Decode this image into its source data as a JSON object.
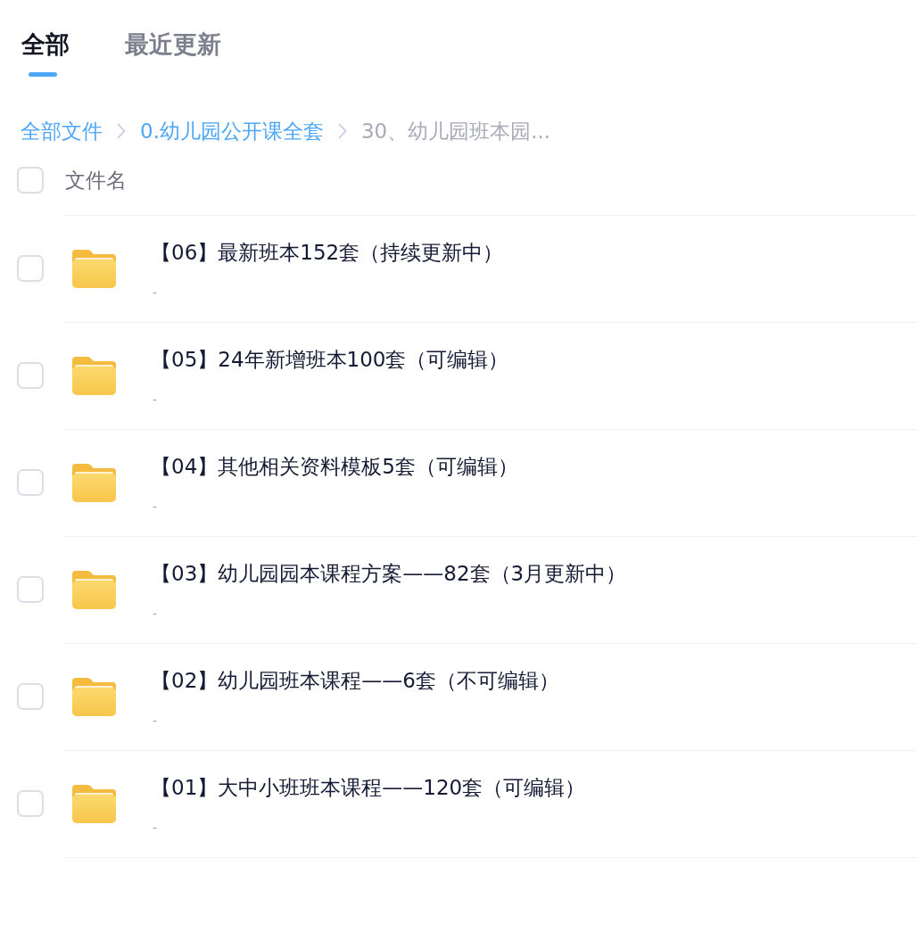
{
  "tabs": [
    {
      "label": "全部",
      "selected": true
    },
    {
      "label": "最近更新",
      "selected": false
    }
  ],
  "breadcrumb": [
    {
      "label": "全部文件",
      "current": false
    },
    {
      "label": "0.幼儿园公开课全套",
      "current": false
    },
    {
      "label": "30、幼儿园班本园...",
      "current": true
    }
  ],
  "header": {
    "checked": false,
    "label": "文件名"
  },
  "files": [
    {
      "name": "【06】最新班本152套（持续更新中）",
      "detail": "-",
      "checked": false
    },
    {
      "name": "【05】24年新增班本100套（可编辑）",
      "detail": "-",
      "checked": false
    },
    {
      "name": "【04】其他相关资料模板5套（可编辑）",
      "detail": "-",
      "checked": false
    },
    {
      "name": "【03】幼儿园园本课程方案——82套（3月更新中）",
      "detail": "-",
      "checked": false
    },
    {
      "name": "【02】幼儿园班本课程——6套（不可编辑）",
      "detail": "-",
      "checked": false
    },
    {
      "name": "【01】大中小班班本课程——120套（可编辑）",
      "detail": "-",
      "checked": false
    }
  ]
}
